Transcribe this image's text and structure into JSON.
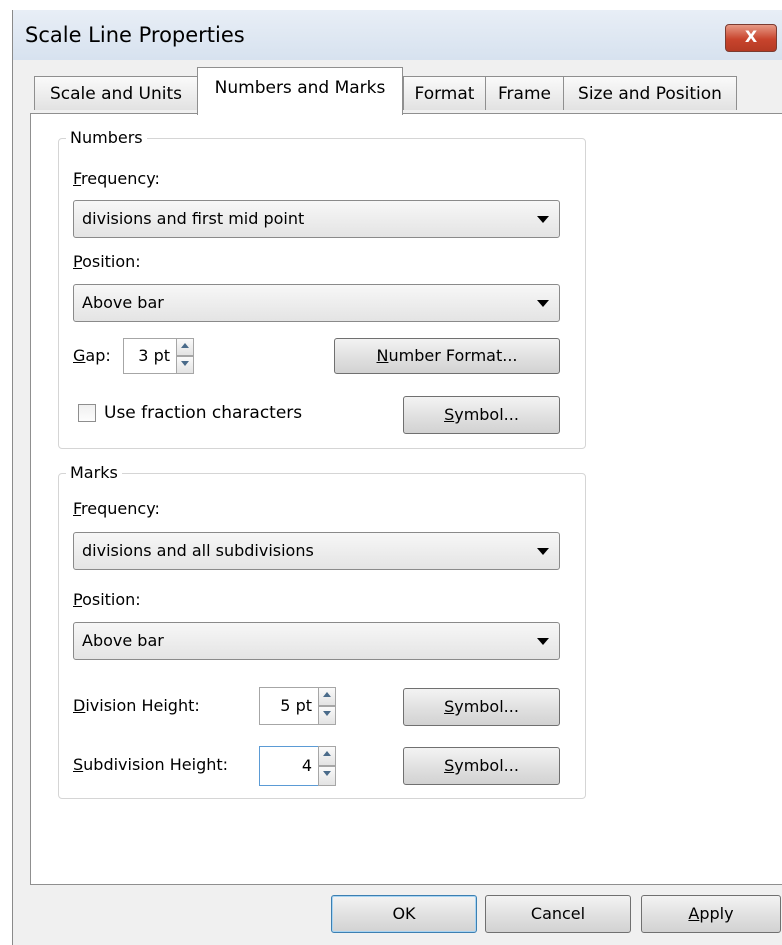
{
  "window": {
    "title": "Scale Line Properties",
    "close_glyph": "X"
  },
  "tabs": [
    {
      "label": "Scale and Units"
    },
    {
      "label": "Numbers and Marks"
    },
    {
      "label": "Format"
    },
    {
      "label": "Frame"
    },
    {
      "label": "Size and Position"
    }
  ],
  "numbers": {
    "legend": "Numbers",
    "frequency_label_mn": "F",
    "frequency_label_rest": "requency:",
    "frequency_value": "divisions and first mid point",
    "position_label_mn": "P",
    "position_label_rest": "osition:",
    "position_value": "Above bar",
    "gap_label_mn": "G",
    "gap_label_rest": "ap:",
    "gap_value": "3 pt",
    "number_format_mn": "N",
    "number_format_rest": "umber Format...",
    "fraction_label": "Use fraction characters",
    "fraction_checked": false,
    "symbol_mn": "S",
    "symbol_rest": "ymbol..."
  },
  "marks": {
    "legend": "Marks",
    "frequency_label_mn": "F",
    "frequency_label_rest": "requency:",
    "frequency_value": "divisions and all subdivisions",
    "position_label_mn": "P",
    "position_label_rest": "osition:",
    "position_value": "Above bar",
    "division_label_mn": "D",
    "division_label_rest": "ivision Height:",
    "division_value": "5 pt",
    "subdivision_label_mn": "S",
    "subdivision_label_rest": "ubdivision Height:",
    "subdivision_value": "4",
    "symbol_mn": "S",
    "symbol_rest": "ymbol..."
  },
  "footer": {
    "ok": "OK",
    "cancel": "Cancel",
    "apply_mn": "A",
    "apply_rest": "pply"
  },
  "colors": {
    "close_red": "#c8442d",
    "panel_bg": "#ffffff",
    "dialog_bg": "#f0f0f0"
  }
}
